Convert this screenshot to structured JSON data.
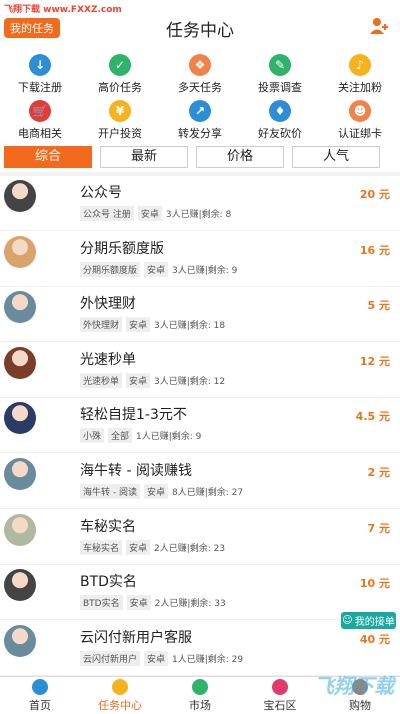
{
  "watermark_top": "飞翔下载 www.FXXZ.com",
  "header": {
    "my_task_button": "我的任务",
    "title": "任务中心",
    "user_icon": "user-plus-icon"
  },
  "categories": [
    {
      "label": "下载注册",
      "icon": "download-icon",
      "color": "#2c8fd6"
    },
    {
      "label": "高价任务",
      "icon": "calendar-check-icon",
      "color": "#2fb36b"
    },
    {
      "label": "多天任务",
      "icon": "cards-icon",
      "color": "#f0834a"
    },
    {
      "label": "投票调查",
      "icon": "edit-icon",
      "color": "#2fb36b"
    },
    {
      "label": "关注加粉",
      "icon": "bell-icon",
      "color": "#f6b31d"
    },
    {
      "label": "电商相关",
      "icon": "cart-icon",
      "color": "#e23b3b"
    },
    {
      "label": "开户投资",
      "icon": "coin-icon",
      "color": "#f6b31d"
    },
    {
      "label": "转发分享",
      "icon": "share-icon",
      "color": "#2c8fd6"
    },
    {
      "label": "好友砍价",
      "icon": "tag-icon",
      "color": "#2c8fd6"
    },
    {
      "label": "认证绑卡",
      "icon": "user-badge-icon",
      "color": "#f0834a"
    }
  ],
  "tabs": [
    "综合",
    "最新",
    "价格",
    "人气"
  ],
  "tasks": [
    {
      "name": "公众号",
      "tag": "公众号 注册",
      "platform": "安卓",
      "stats": "3人已赚|剩余: 8",
      "price": "20 元",
      "avatar_color": "#444"
    },
    {
      "name": "分期乐额度版",
      "tag": "分期乐额度版",
      "platform": "安卓",
      "stats": "3人已赚|剩余: 9",
      "price": "16 元",
      "avatar_color": "#d9a36b"
    },
    {
      "name": "外快理财",
      "tag": "外快理财",
      "platform": "安卓",
      "stats": "3人已赚|剩余: 18",
      "price": "5 元",
      "avatar_color": "#6a8a9e"
    },
    {
      "name": "光速秒单",
      "tag": "光速秒单",
      "platform": "安卓",
      "stats": "3人已赚|剩余: 12",
      "price": "12 元",
      "avatar_color": "#7a3d2a"
    },
    {
      "name": "轻松自提1-3元不",
      "tag": "小殊",
      "platform": "全部",
      "stats": "1人已赚|剩余: 9",
      "price": "4.5 元",
      "avatar_color": "#2b3a66"
    },
    {
      "name": "海牛转 - 阅读赚钱",
      "tag": "海牛转 - 阅读",
      "platform": "安卓",
      "stats": "8人已赚|剩余: 27",
      "price": "2 元",
      "avatar_color": "#6a8a9e"
    },
    {
      "name": "车秘实名",
      "tag": "车秘实名",
      "platform": "安卓",
      "stats": "2人已赚|剩余: 23",
      "price": "7 元",
      "avatar_color": "#b0b8a0"
    },
    {
      "name": "BTD实名",
      "tag": "BTD实名",
      "platform": "安卓",
      "stats": "2人已赚|剩余: 33",
      "price": "10 元",
      "avatar_color": "#444"
    },
    {
      "name": "云闪付新用户客服",
      "tag": "云闪付新用户",
      "platform": "安卓",
      "stats": "1人已赚|剩余: 29",
      "price": "40 元",
      "avatar_color": "#6a8a9e"
    }
  ],
  "float_button": "我的接单",
  "bottom_nav": [
    {
      "label": "首页",
      "icon": "home-icon",
      "color": "#2c8fd6"
    },
    {
      "label": "任务中心",
      "icon": "task-icon",
      "color": "#f6b31d"
    },
    {
      "label": "市场",
      "icon": "market-icon",
      "color": "#2fb36b"
    },
    {
      "label": "宝石区",
      "icon": "gem-icon",
      "color": "#e23b6b"
    },
    {
      "label": "购物",
      "icon": "shop-icon",
      "color": "#888"
    }
  ],
  "watermark_bottom": "飞翔下载"
}
